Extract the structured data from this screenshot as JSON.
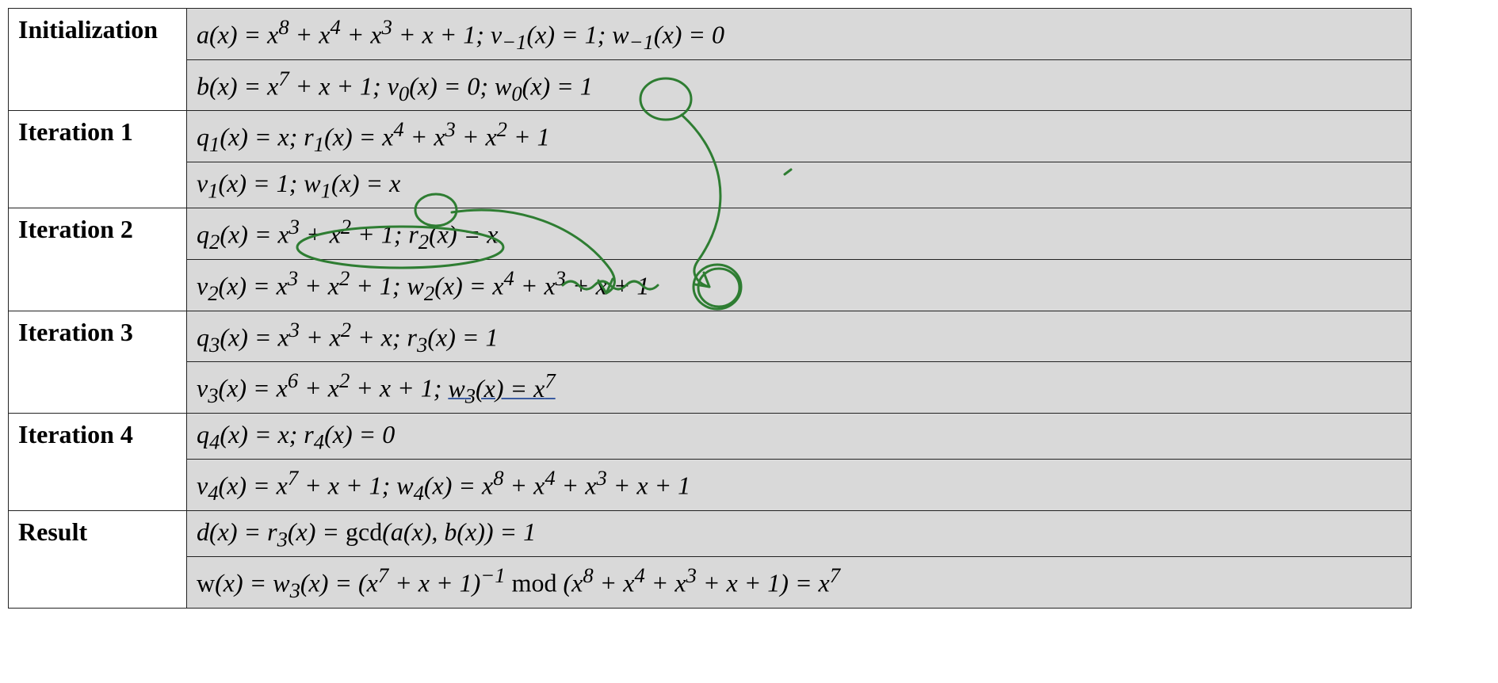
{
  "rows": [
    {
      "label": "Initialization",
      "lines": [
        "a(x) = x<sup>8</sup> + x<sup>4</sup> + x<sup>3</sup> + x + 1; v<sub>−1</sub>(x) = 1; w<sub>−1</sub>(x) = 0",
        "b(x) = x<sup>7</sup> + x + 1; v<sub>0</sub>(x) = 0; w<sub>0</sub>(x) = 1"
      ]
    },
    {
      "label": "Iteration 1",
      "lines": [
        "q<sub>1</sub>(x) = x; r<sub>1</sub>(x) = x<sup>4</sup> + x<sup>3</sup> + x<sup>2</sup> + 1",
        "v<sub>1</sub>(x) = 1; w<sub>1</sub>(x) = x"
      ]
    },
    {
      "label": "Iteration 2",
      "lines": [
        "q<sub>2</sub>(x) = x<sup>3</sup> + x<sup>2</sup> + 1; r<sub>2</sub>(x) = x",
        "v<sub>2</sub>(x) = x<sup>3</sup> + x<sup>2</sup> + 1; w<sub>2</sub>(x) = x<sup>4</sup> + x<sup>3</sup> + x + 1"
      ]
    },
    {
      "label": "Iteration 3",
      "lines": [
        "q<sub>3</sub>(x) = x<sup>3</sup> + x<sup>2</sup> + x; r<sub>3</sub>(x) = 1",
        "v<sub>3</sub>(x) = x<sup>6</sup> + x<sup>2</sup> + x + 1; <span class='underline-note'>w<sub>3</sub>(x) = x<sup>7</sup></span>"
      ]
    },
    {
      "label": "Iteration 4",
      "lines": [
        "q<sub>4</sub>(x) = x; r<sub>4</sub>(x) = 0",
        "v<sub>4</sub>(x) = x<sup>7</sup> + x + 1; w<sub>4</sub>(x) = x<sup>8</sup> + x<sup>4</sup> + x<sup>3</sup> + x + 1"
      ]
    },
    {
      "label": "Result",
      "lines": [
        "d(x) = r<sub>3</sub>(x) = <span class='upright'>gcd</span>(a(x), b(x)) = 1",
        "<span class='upright'>w</span>(x) = w<sub>3</sub>(x) = (x<sup>7</sup> + x + 1)<sup>−1</sup> <span class='upright'>mod</span> (x<sup>8</sup> + x<sup>4</sup> + x<sup>3</sup> + x + 1) = x<sup>7</sup>"
      ]
    }
  ],
  "annotations": {
    "stroke": "#2e7d32",
    "description": "Hand-drawn green circles and arrows linking w0(x)=1, w1(x)=x, q2(x)=x³+x²+1 into w2(x)=x⁴+x³+x+1"
  }
}
